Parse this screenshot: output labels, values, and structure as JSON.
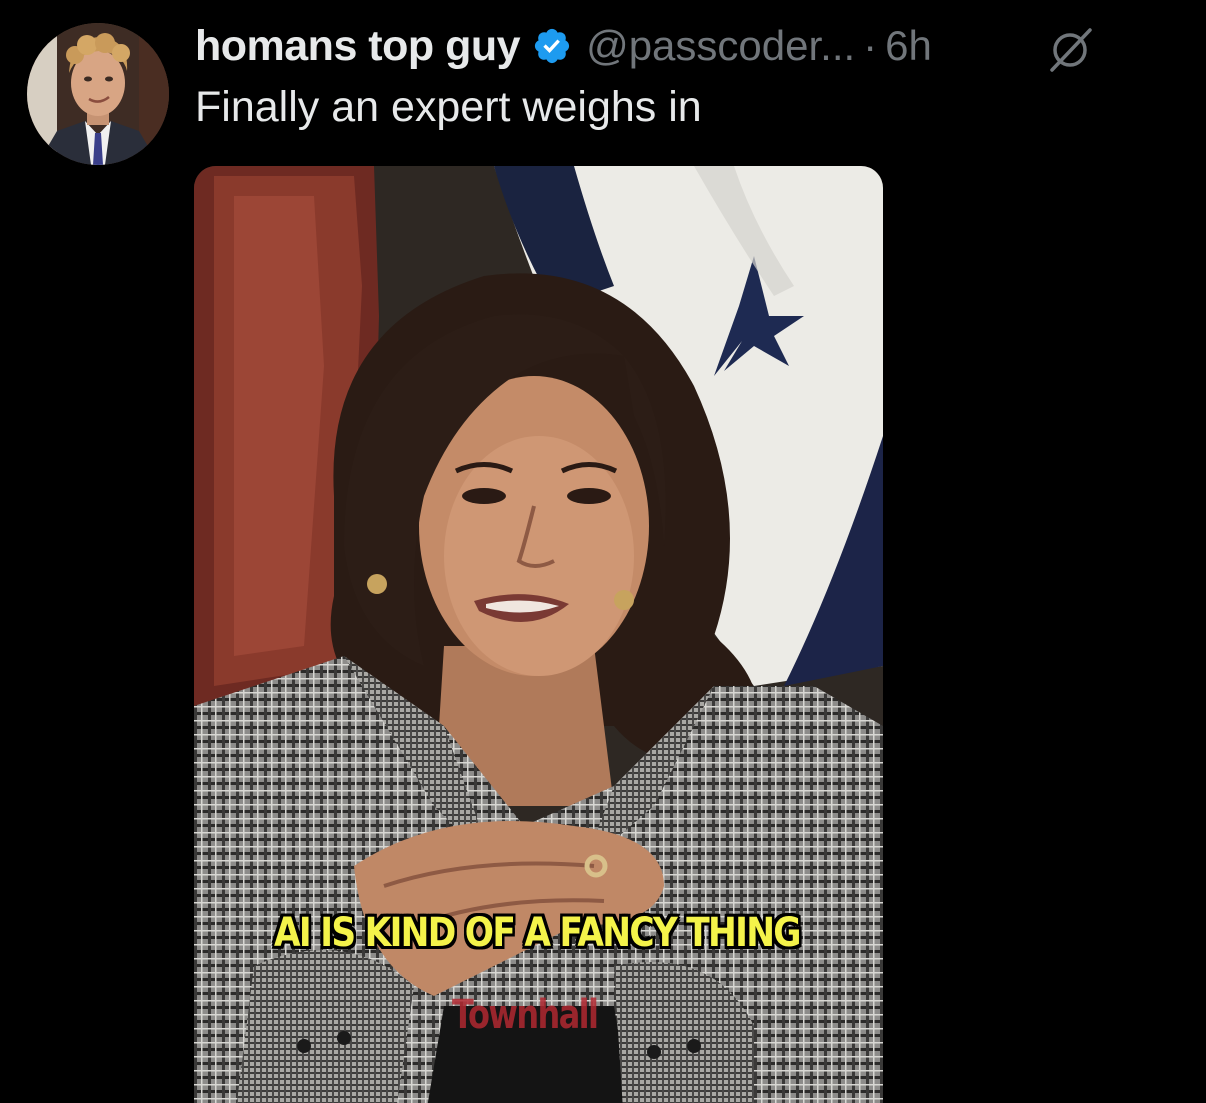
{
  "tweet": {
    "display_name": "homans top guy",
    "handle": "@passcoder...",
    "separator": "·",
    "timestamp": "6h",
    "text": "Finally an expert weighs in"
  },
  "icons": {
    "verified": "verified-badge-icon",
    "grok": "grok-icon",
    "avatar": "profile-avatar"
  },
  "media": {
    "caption": "AI IS KIND OF A FANCY THING",
    "watermark": "Townhall"
  },
  "colors": {
    "background": "#000000",
    "text_primary": "#e7e9ea",
    "text_secondary": "#71767b",
    "verified_blue": "#1d9bf0",
    "caption_yellow": "#f4f34a",
    "watermark_red": "#b02830"
  }
}
